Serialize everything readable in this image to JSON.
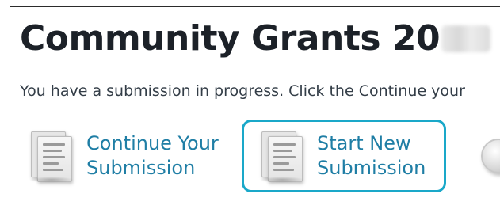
{
  "page": {
    "title": "Community Grants 20",
    "intro": "You have a submission in progress. Click the Continue your"
  },
  "options": [
    {
      "line1": "Continue Your",
      "line2": "Submission",
      "icon": "document-icon"
    },
    {
      "line1": "Start New",
      "line2": "Submission",
      "icon": "document-icon",
      "selected": true
    },
    {
      "icon": "circle-icon"
    }
  ],
  "colors": {
    "title": "#1c2128",
    "link": "#1f7ea5",
    "selected_border": "#1aa8c9",
    "body_text": "#333d47"
  }
}
